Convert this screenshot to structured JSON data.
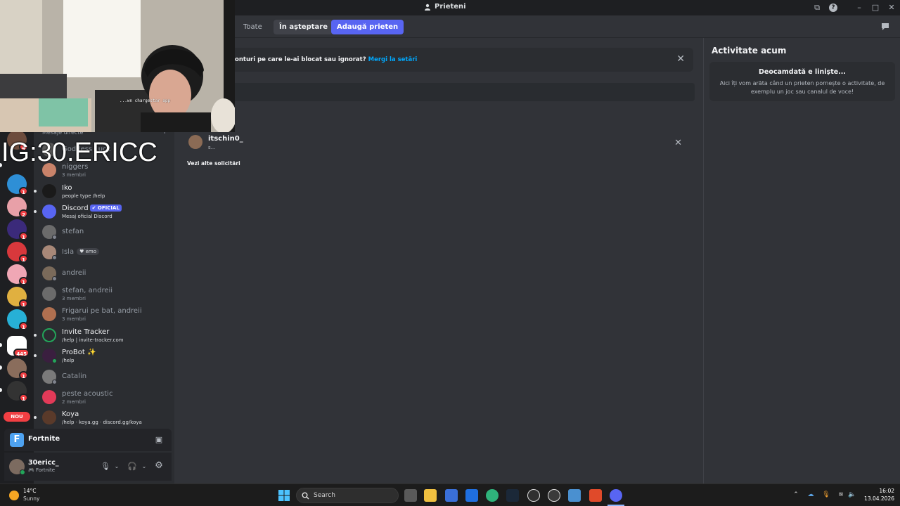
{
  "window": {
    "title": "Prieteni"
  },
  "friends_tabs": [
    {
      "label": "Toate"
    },
    {
      "label": "În așteptare"
    },
    {
      "label": "Adaugă prieten"
    }
  ],
  "notice": {
    "text": "onturi pe care le-ai blocat sau ignorat?",
    "link": "Mergi la setări"
  },
  "pending_request": {
    "name": "itschin0_",
    "sub": "s...",
    "see_more": "Vezi alte solicitări"
  },
  "activity": {
    "title": "Activitate acum",
    "head": "Deocamdată e liniște...",
    "body": "Aici îți vom arăta când un prieten pornește o activitate, de exemplu un joc sau canalul de voce!"
  },
  "webcam_caption": "...wn chargestar app",
  "overlay_text": "IG:30.ERICC",
  "dm": {
    "section_label": "Mesaje directe",
    "plus": "+",
    "items": [
      {
        "name": "Goddess Luck",
        "sub": ""
      },
      {
        "name": "niggers",
        "sub": "3 membri"
      },
      {
        "name": "Iko",
        "sub": "people type /help"
      },
      {
        "name": "Discord",
        "pill": "✔ OFICIAL",
        "sub": "Mesaj oficial Discord"
      },
      {
        "name": "stefan",
        "sub": ""
      },
      {
        "name": "Isla",
        "tag": "♥ emo",
        "sub": ""
      },
      {
        "name": "andreii",
        "sub": ""
      },
      {
        "name": "stefan, andreii",
        "sub": "3 membri"
      },
      {
        "name": "Frigarui pe bat, andreii",
        "sub": "3 membri"
      },
      {
        "name": "Invite Tracker",
        "sub": "/help | invite-tracker.com"
      },
      {
        "name": "ProBot ✨",
        "sub": "/help"
      },
      {
        "name": "Catalin",
        "sub": ""
      },
      {
        "name": "peste acoustic",
        "sub": "2 membri"
      },
      {
        "name": "Koya",
        "sub": "/help · koya.gg · discord.gg/koya"
      }
    ]
  },
  "servers": [
    {
      "badge": "4",
      "color": "#6d4c3d"
    },
    {
      "badge": "1",
      "color": "#2e8fd6"
    },
    {
      "badge": "2",
      "color": "#e8a0a8"
    },
    {
      "badge": "1",
      "color": "#3b2a7a"
    },
    {
      "badge": "1",
      "color": "#d8383c"
    },
    {
      "badge": "1",
      "color": "#f0a7b5"
    },
    {
      "badge": "1",
      "color": "#e0b040"
    },
    {
      "badge": "1",
      "color": "#27b0d6"
    },
    {
      "badge": "445",
      "color": "#ffffff"
    },
    {
      "badge": "1",
      "color": "#8a6d5c"
    },
    {
      "badge": "1",
      "color": "#333333"
    }
  ],
  "nou_label": "NOU",
  "voice": {
    "label": "Fortnite",
    "icon_letter": "F"
  },
  "user": {
    "name": "30ericc_",
    "status": "🎮 Fortnite"
  },
  "taskbar": {
    "weather_temp": "14°C",
    "weather_desc": "Sunny",
    "search_label": "Search",
    "time": "16:02",
    "date": "13.04.2026"
  }
}
